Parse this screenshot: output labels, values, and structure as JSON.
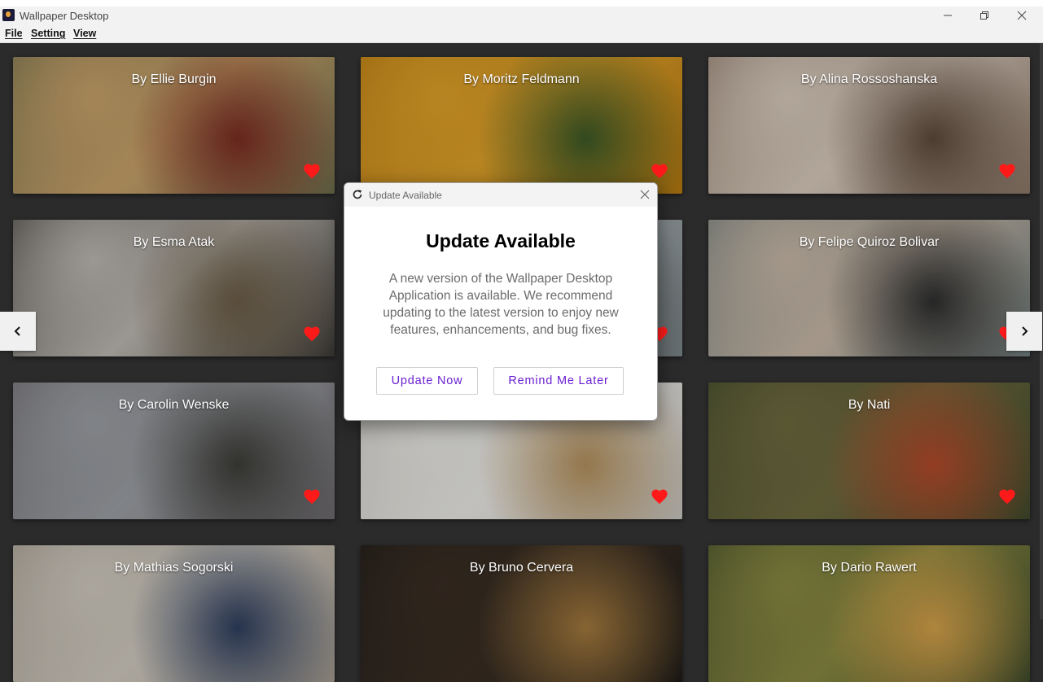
{
  "window": {
    "title": "Wallpaper Desktop",
    "minimize_icon": "minimize-icon",
    "maximize_icon": "restore-icon",
    "close_icon": "close-icon"
  },
  "menu": [
    {
      "label": "File"
    },
    {
      "label": "Setting"
    },
    {
      "label": "View"
    }
  ],
  "gallery": {
    "cards": [
      {
        "caption": "By Ellie Burgin",
        "colors": [
          "#6e6f4e",
          "#c9a36a",
          "#7b2d22"
        ]
      },
      {
        "caption": "By Moritz Feldmann",
        "colors": [
          "#b87a10",
          "#e0a22a",
          "#3d5a26"
        ]
      },
      {
        "caption": "By Alina  Rossoshanska",
        "colors": [
          "#8c7868",
          "#d9cbbd",
          "#5e4a3c"
        ]
      },
      {
        "caption": "By Esma Atak",
        "colors": [
          "#3d3b37",
          "#bdb9b2",
          "#6d5e48"
        ]
      },
      {
        "caption": "",
        "colors": [
          "#7a8488",
          "#a8b0b3",
          "#5b5e5c"
        ]
      },
      {
        "caption": "By Felipe Quiroz Bolivar",
        "colors": [
          "#6e7c7c",
          "#c8b9a8",
          "#2f2f2f"
        ]
      },
      {
        "caption": "By Carolin Wenske",
        "colors": [
          "#6d6a6e",
          "#9da0a5",
          "#3e3e3a"
        ]
      },
      {
        "caption": "",
        "colors": [
          "#c9c6c0",
          "#ecebe7",
          "#b5925e"
        ]
      },
      {
        "caption": "By Nati",
        "colors": [
          "#3e4a2c",
          "#6e6a3e",
          "#b34a2a"
        ]
      },
      {
        "caption": "By Mathias Sogorski",
        "colors": [
          "#a29a8e",
          "#d1cbc0",
          "#2f3f5f"
        ]
      },
      {
        "caption": "By Bruno Cervera",
        "colors": [
          "#1e1b18",
          "#3a2e24",
          "#a57b3e"
        ]
      },
      {
        "caption": "By Dario Rawert",
        "colors": [
          "#3e4a2a",
          "#8a8a42",
          "#d6a24a"
        ]
      }
    ],
    "heart_color": "#ff1a1a",
    "prev_icon": "chevron-left-icon",
    "next_icon": "chevron-right-icon"
  },
  "dialog": {
    "window_title": "Update Available",
    "heading": "Update Available",
    "message": "A new version of the Wallpaper Desktop Application is available. We recommend updating to the latest version to enjoy new features, enhancements, and bug fixes.",
    "update_now": "Update Now",
    "remind_later": "Remind Me Later",
    "accent": "#6a1fd1"
  }
}
